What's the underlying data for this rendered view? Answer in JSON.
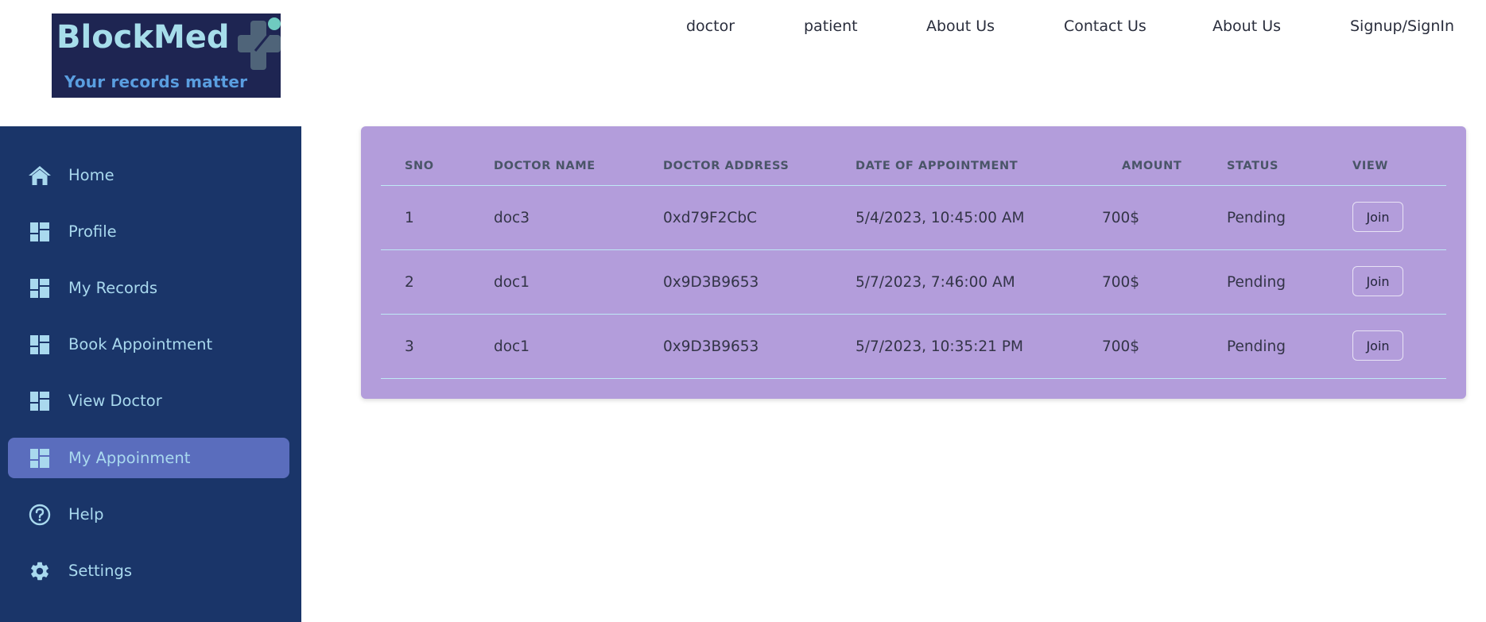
{
  "brand": {
    "title": "BlockMed",
    "tagline": "Your records matter",
    "logo_icon": "medical-cross-icon",
    "colors": {
      "logo_bg": "#1e2552",
      "logo_title": "#a6ddea",
      "logo_tagline": "#5a9ee0",
      "cross": "#4f6479",
      "dot": "#6fcac0"
    }
  },
  "nav": {
    "items": [
      {
        "label": "doctor"
      },
      {
        "label": "patient"
      },
      {
        "label": "About Us"
      },
      {
        "label": "Contact Us"
      },
      {
        "label": "About Us"
      },
      {
        "label": "Signup/SignIn"
      }
    ]
  },
  "sidebar": {
    "colors": {
      "bg": "#1a3569",
      "active_bg": "#5a6dbd",
      "text": "#a9d9ee"
    },
    "active_index": 5,
    "items": [
      {
        "label": "Home",
        "icon": "home-icon"
      },
      {
        "label": "Profile",
        "icon": "dashboard-icon"
      },
      {
        "label": "My Records",
        "icon": "dashboard-icon"
      },
      {
        "label": "Book Appointment",
        "icon": "dashboard-icon"
      },
      {
        "label": "View Doctor",
        "icon": "dashboard-icon"
      },
      {
        "label": "My Appoinment",
        "icon": "dashboard-icon"
      },
      {
        "label": "Help",
        "icon": "help-circle-icon"
      },
      {
        "label": "Settings",
        "icon": "gear-icon"
      }
    ]
  },
  "appointments": {
    "colors": {
      "card_bg": "#b39ddb",
      "divider": "#bfe9f5",
      "header_text": "#4a5568"
    },
    "columns": {
      "sno": "SNO",
      "doctor_name": "DOCTOR NAME",
      "doctor_address": "DOCTOR ADDRESS",
      "date": "DATE OF APPOINTMENT",
      "amount": "AMOUNT",
      "status": "STATUS",
      "view": "VIEW"
    },
    "rows": [
      {
        "sno": "1",
        "doctor_name": "doc3",
        "doctor_address": "0xd79F2CbC",
        "date": "5/4/2023, 10:45:00 AM",
        "amount": "700$",
        "status": "Pending",
        "action": "Join"
      },
      {
        "sno": "2",
        "doctor_name": "doc1",
        "doctor_address": "0x9D3B9653",
        "date": "5/7/2023, 7:46:00 AM",
        "amount": "700$",
        "status": "Pending",
        "action": "Join"
      },
      {
        "sno": "3",
        "doctor_name": "doc1",
        "doctor_address": "0x9D3B9653",
        "date": "5/7/2023, 10:35:21 PM",
        "amount": "700$",
        "status": "Pending",
        "action": "Join"
      }
    ]
  }
}
